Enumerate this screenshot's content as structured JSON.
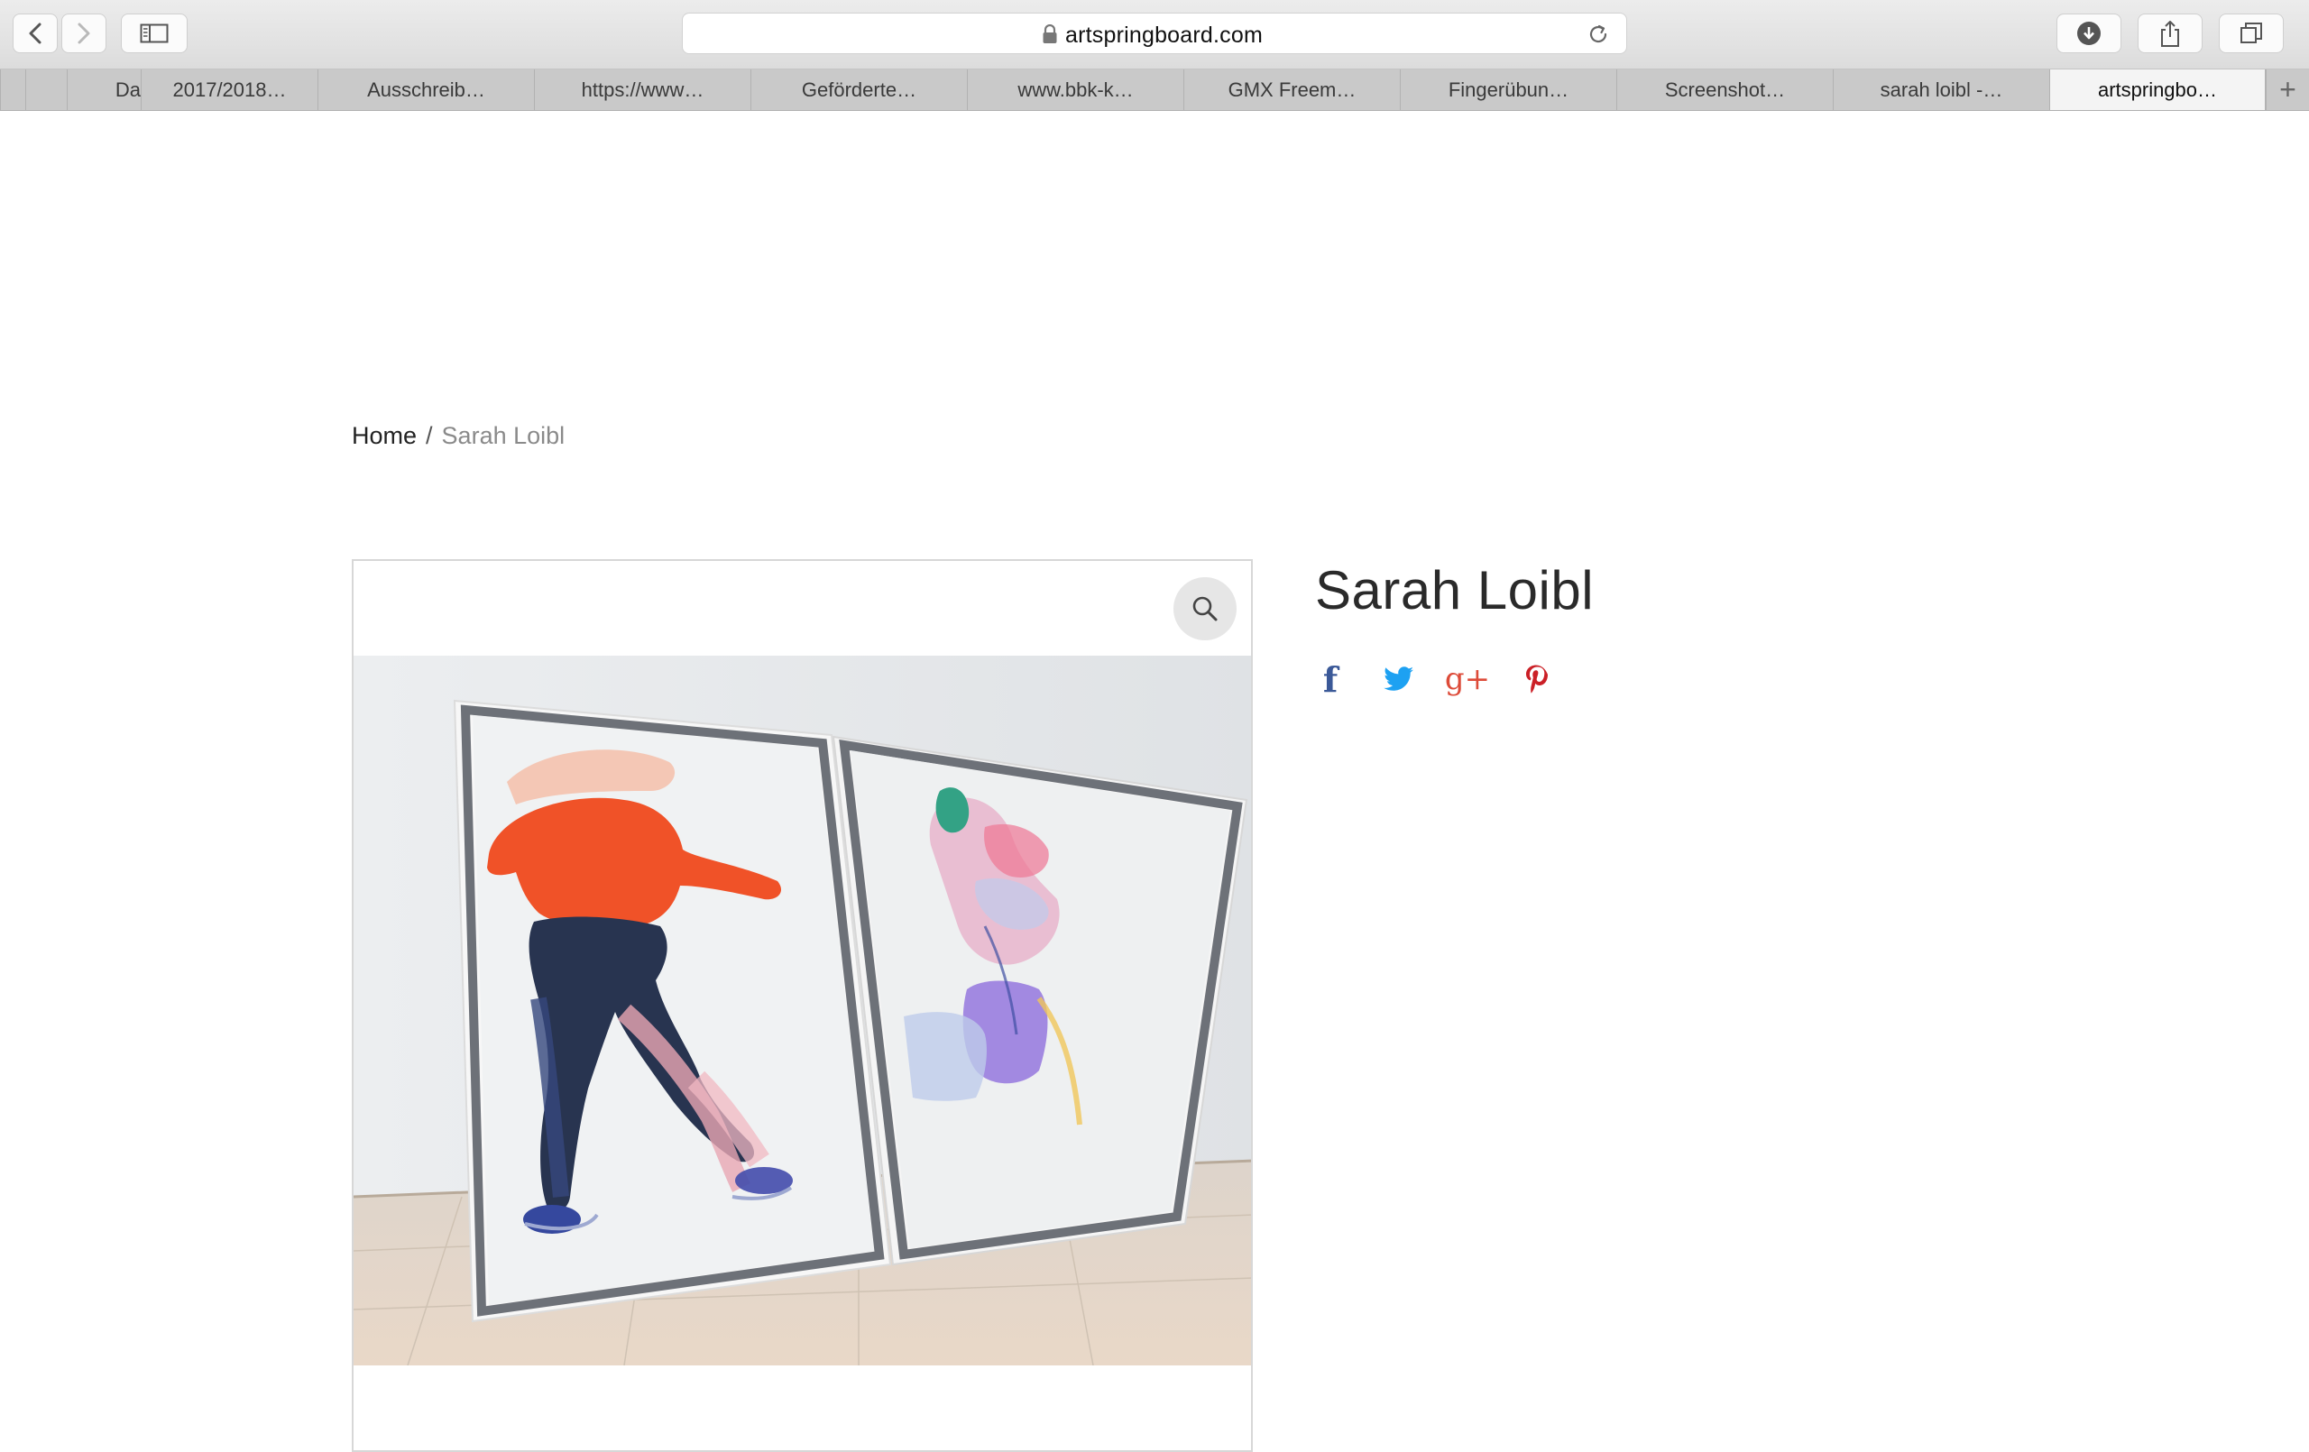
{
  "browser": {
    "url": "artspringboard.com",
    "tabs": [
      {
        "label": "Da"
      },
      {
        "label": "2017/2018…"
      },
      {
        "label": "Ausschreib…"
      },
      {
        "label": "https://www…"
      },
      {
        "label": "Geförderte…"
      },
      {
        "label": "www.bbk-k…"
      },
      {
        "label": "GMX Freem…"
      },
      {
        "label": "Fingerübun…"
      },
      {
        "label": "Screenshot…"
      },
      {
        "label": "sarah loibl -…"
      },
      {
        "label": "artspringbo…"
      }
    ],
    "new_tab_label": "+"
  },
  "breadcrumb": {
    "home": "Home",
    "separator": "/",
    "current": "Sarah Loibl"
  },
  "product": {
    "title": "Sarah Loibl"
  },
  "share": {
    "facebook_glyph": "f",
    "google_plus_glyph": "g+",
    "colors": {
      "facebook": "#3b5998",
      "twitter": "#1da1f2",
      "google_plus": "#dd4b39",
      "pinterest": "#cb2027"
    }
  },
  "icons": {
    "back": "chevron-left-icon",
    "forward": "chevron-right-icon",
    "sidebar": "sidebar-icon",
    "lock": "lock-icon",
    "reload": "reload-icon",
    "downloads": "download-icon",
    "share": "share-icon",
    "tabs": "tabs-overview-icon",
    "zoom": "search-icon"
  }
}
